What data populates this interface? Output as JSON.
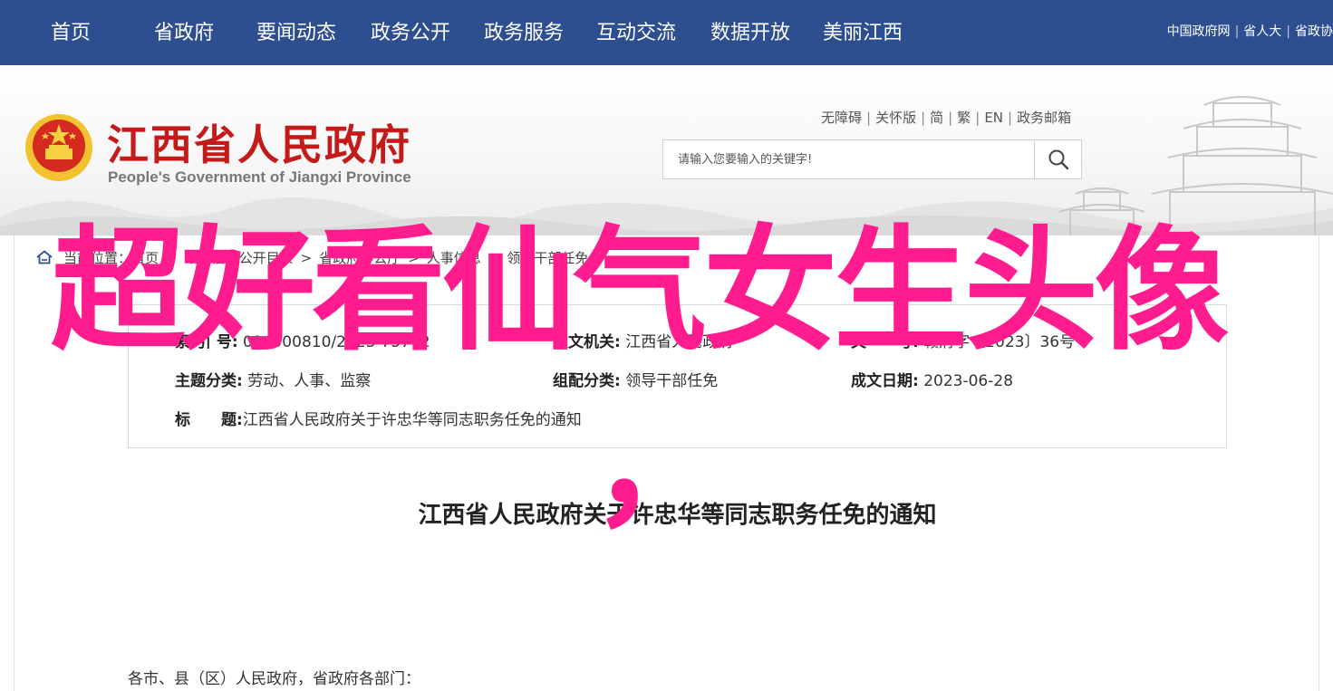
{
  "nav": {
    "items": [
      "首页",
      "省政府",
      "要闻动态",
      "政务公开",
      "政务服务",
      "互动交流",
      "数据开放",
      "美丽江西"
    ],
    "links": [
      "中国政府网",
      "省人大",
      "省政协"
    ]
  },
  "header": {
    "title_cn": "江西省人民政府",
    "title_en": "People's Government of Jiangxi Province",
    "util_links": [
      "无障碍",
      "关怀版",
      "简",
      "繁",
      "EN",
      "政务邮箱"
    ],
    "search_placeholder": "请输入您要输入的关键字!"
  },
  "breadcrumb": {
    "prefix": "当前位置：",
    "items": [
      "首页",
      "政府信息公开目录",
      "省政府办公厅",
      "人事信息",
      "领导干部任免"
    ]
  },
  "doc_info": {
    "index_label": "索 引 号:",
    "index_value": "014500810/2023-75742",
    "issuer_label": "发文机关:",
    "issuer_value": "江西省人民政府",
    "docno_label": "文　　号:",
    "docno_value": "赣府字〔2023〕36号",
    "topic_label": "主题分类:",
    "topic_value": "劳动、人事、监察",
    "org_label": "组配分类:",
    "org_value": "领导干部任免",
    "date_label": "成文日期:",
    "date_value": "2023-06-28",
    "title_label": "标　　题:",
    "title_value": "江西省人民政府关于许忠华等同志职务任免的通知"
  },
  "document": {
    "title": "江西省人民政府关于许忠华等同志职务任免的通知",
    "salutation": "各市、县（区）人民政府，省政府各部门："
  },
  "overlay": {
    "text": "超好看仙气女生头像",
    "comma": "，",
    "color": "#ff1c8e"
  },
  "colors": {
    "nav_bg": "#2e4f8f",
    "logo_red": "#c41a1a"
  }
}
